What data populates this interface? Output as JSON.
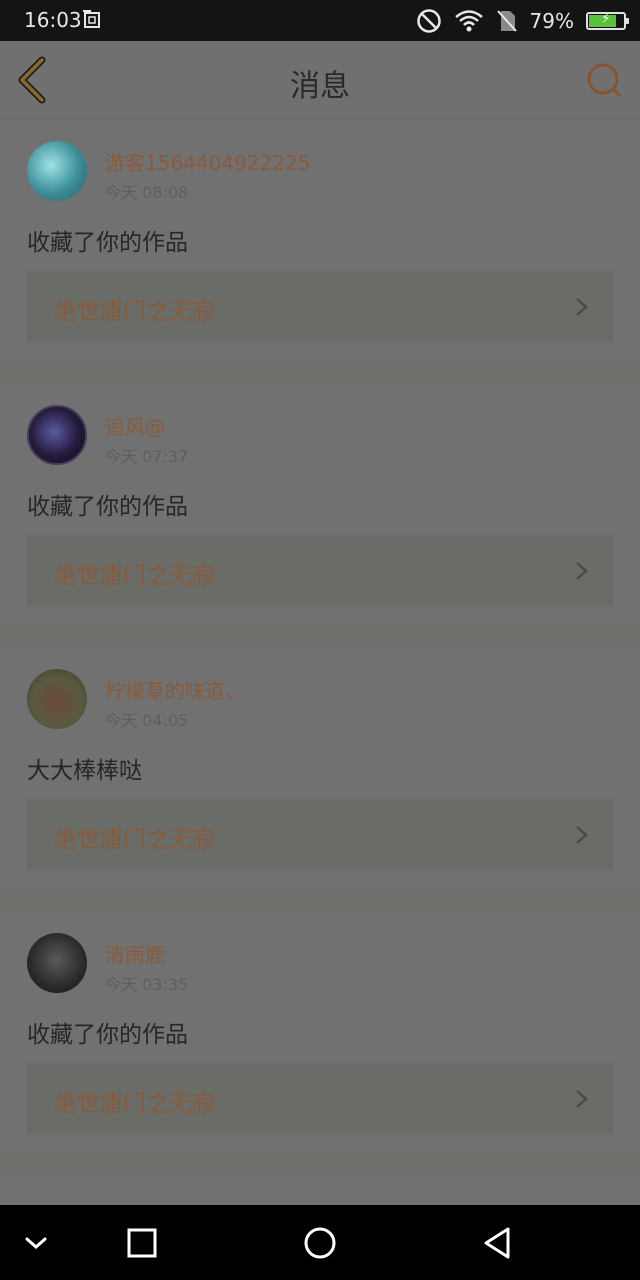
{
  "status_bar": {
    "time": "16:03",
    "battery_percent": "79%",
    "battery_level": 0.79,
    "icons": [
      "screenshot-notification-icon",
      "do-not-disturb-icon",
      "wifi-icon",
      "no-sim-icon",
      "battery-charging-icon"
    ]
  },
  "header": {
    "title": "消息",
    "back_icon": "chevron-left-icon",
    "search_icon": "search-icon",
    "accent_color": "#8a6a2a"
  },
  "messages": [
    {
      "username": "游客1564404922225",
      "time": "今天 08:08",
      "text": "收藏了你的作品",
      "work_title": "绝世唐门之无寂"
    },
    {
      "username": "追风@",
      "time": "今天 07:37",
      "text": "收藏了你的作品",
      "work_title": "绝世唐门之无寂"
    },
    {
      "username": "柠檬草的味道、",
      "time": "今天 04:05",
      "text": "大大棒棒哒",
      "work_title": "绝世唐门之无寂"
    },
    {
      "username": "清雨鹿",
      "time": "今天 03:35",
      "text": "收藏了你的作品",
      "work_title": "绝世唐门之无寂"
    }
  ],
  "nav_bar": {
    "buttons": [
      "collapse-icon",
      "recents-icon",
      "home-icon",
      "back-icon"
    ]
  }
}
